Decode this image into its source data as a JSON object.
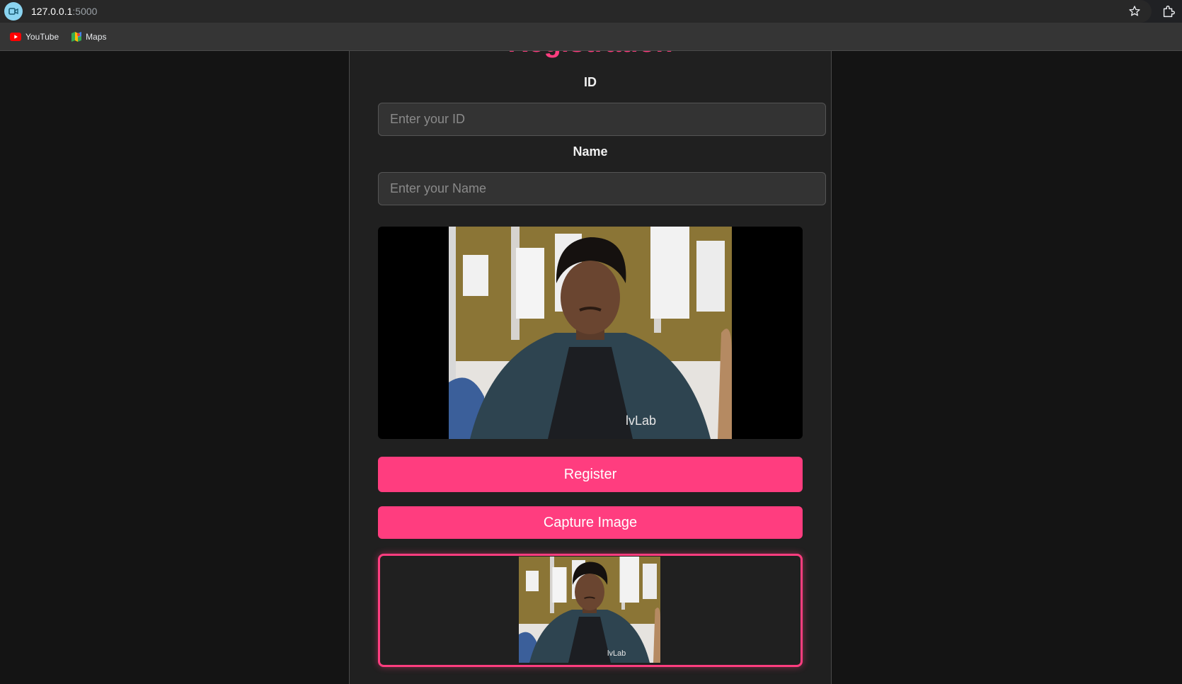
{
  "browser": {
    "url_host": "127.0.0.1",
    "url_port": ":5000",
    "bookmarks": [
      {
        "label": "YouTube",
        "icon": "youtube-icon"
      },
      {
        "label": "Maps",
        "icon": "maps-icon"
      }
    ]
  },
  "form": {
    "heading": "Registration",
    "id_label": "ID",
    "id_placeholder": "Enter your ID",
    "id_value": "",
    "name_label": "Name",
    "name_placeholder": "Enter your Name",
    "name_value": "",
    "register_label": "Register",
    "capture_label": "Capture Image",
    "shirt_logo": "lvLab"
  },
  "colors": {
    "accent": "#ff3d7f",
    "page_bg": "#141414",
    "card_bg": "#202020",
    "input_bg": "#333333"
  }
}
